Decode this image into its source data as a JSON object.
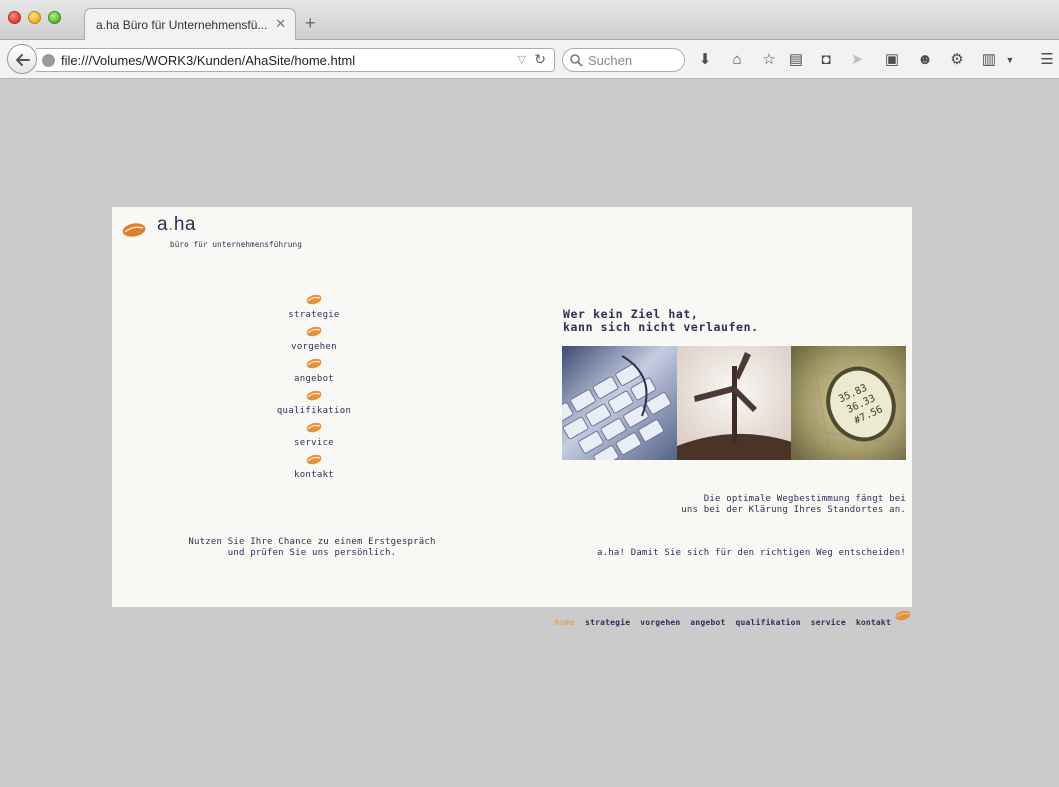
{
  "browser": {
    "tab_title": "a.ha Büro für Unternehmensfü...",
    "url": "file:///Volumes/WORK3/Kunden/AhaSite/home.html",
    "search_placeholder": "Suchen"
  },
  "site": {
    "logo_text": "a.ha",
    "logo_subtitle": "büro für unternehmensführung",
    "menu": [
      {
        "label": "strategie"
      },
      {
        "label": "vorgehen"
      },
      {
        "label": "angebot"
      },
      {
        "label": "qualifikation"
      },
      {
        "label": "service"
      },
      {
        "label": "kontakt"
      }
    ],
    "chance_line1": "Nutzen Sie Ihre Chance zu einem Erstgespräch",
    "chance_line2": "und prüfen Sie uns persönlich.",
    "headline_line1": "Wer kein Ziel hat,",
    "headline_line2": "kann sich nicht verlaufen.",
    "text1_line1": "Die optimale Wegbestimmung fängt bei",
    "text1_line2": "uns bei der Klärung Ihres Standortes an.",
    "text2": "a.ha! Damit Sie sich für den richtigen Weg entscheiden!",
    "footer_nav": [
      {
        "label": "home",
        "active": true
      },
      {
        "label": "strategie"
      },
      {
        "label": "vorgehen"
      },
      {
        "label": "angebot"
      },
      {
        "label": "qualifikation"
      },
      {
        "label": "service"
      },
      {
        "label": "kontakt"
      }
    ],
    "colors": {
      "accent": "#e7913c",
      "text": "#2d3055",
      "page_bg": "#f8f8f4",
      "outer_bg": "#cbcbcb"
    }
  }
}
